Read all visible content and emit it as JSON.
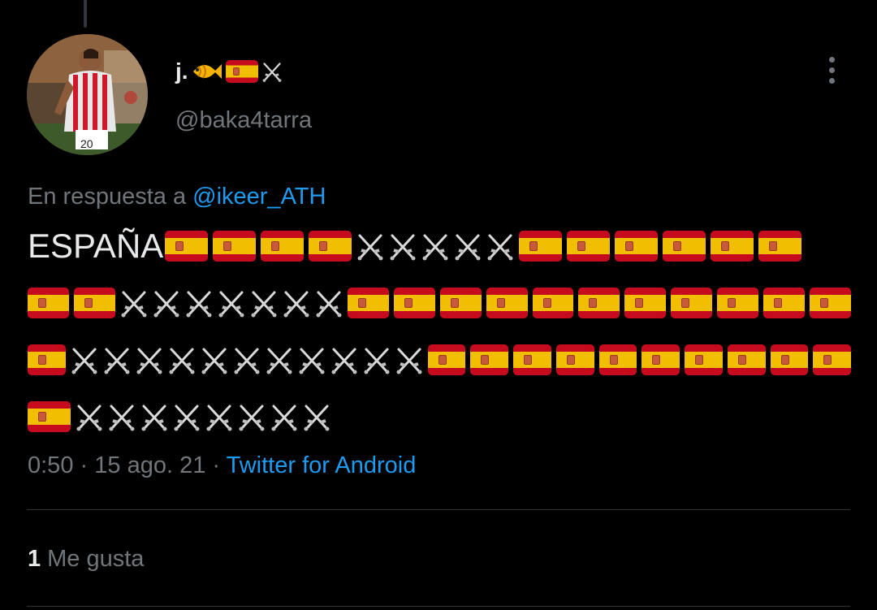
{
  "author": {
    "display_name": "j.",
    "name_emojis": [
      "fish-emoji",
      "spain-flag-emoji",
      "crossed-swords-emoji"
    ],
    "handle": "@baka4tarra"
  },
  "reply": {
    "prefix": "En respuesta a",
    "mention": "@ikeer_ATH"
  },
  "tweet": {
    "lines": [
      {
        "text": "ESPAÑA",
        "emojis": [
          "flag",
          "flag",
          "flag",
          "flag",
          "swords",
          "swords",
          "swords",
          "swords",
          "swords",
          "flag",
          "flag",
          "flag",
          "flag",
          "flag",
          "flag"
        ]
      },
      {
        "text": "",
        "emojis": [
          "flag",
          "flag",
          "swords",
          "swords",
          "swords",
          "swords",
          "swords",
          "swords",
          "swords",
          "flag",
          "flag",
          "flag",
          "flag",
          "flag",
          "flag",
          "flag",
          "flag",
          "flag",
          "flag",
          "flag"
        ]
      },
      {
        "text": "",
        "emojis": [
          "flag",
          "swords",
          "swords",
          "swords",
          "swords",
          "swords",
          "swords",
          "swords",
          "swords",
          "swords",
          "swords",
          "swords",
          "flag",
          "flag",
          "flag",
          "flag",
          "flag",
          "flag",
          "flag",
          "flag",
          "flag",
          "flag"
        ]
      },
      {
        "text": "",
        "emojis": [
          "flag",
          "swords",
          "swords",
          "swords",
          "swords",
          "swords",
          "swords",
          "swords",
          "swords"
        ]
      }
    ]
  },
  "meta": {
    "time": "0:50",
    "separator": "·",
    "date": "15 ago. 21",
    "source": "Twitter for Android"
  },
  "engagement": {
    "likes_count": "1",
    "likes_label": "Me gusta"
  },
  "colors": {
    "background": "#000000",
    "text": "#e7e9ea",
    "muted": "#71767b",
    "link": "#1d9bf0"
  },
  "icons": {
    "more": "more-options-icon"
  }
}
